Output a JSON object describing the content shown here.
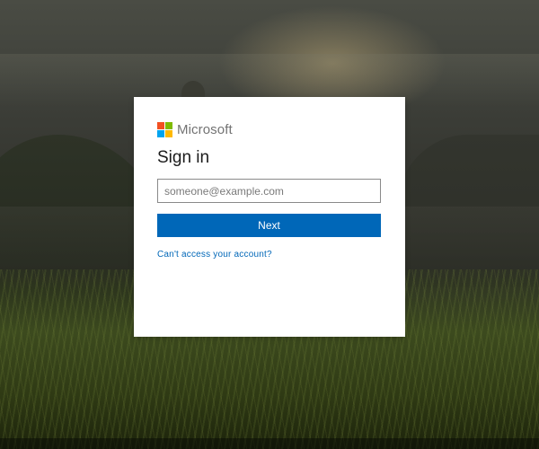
{
  "brand": {
    "name": "Microsoft",
    "logo_colors": [
      "#f25022",
      "#7fba00",
      "#00a4ef",
      "#ffb900"
    ]
  },
  "signin": {
    "title": "Sign in",
    "email_placeholder": "someone@example.com",
    "email_value": "",
    "next_label": "Next",
    "help_link": "Can't access your account?"
  },
  "colors": {
    "accent": "#0067b8"
  }
}
